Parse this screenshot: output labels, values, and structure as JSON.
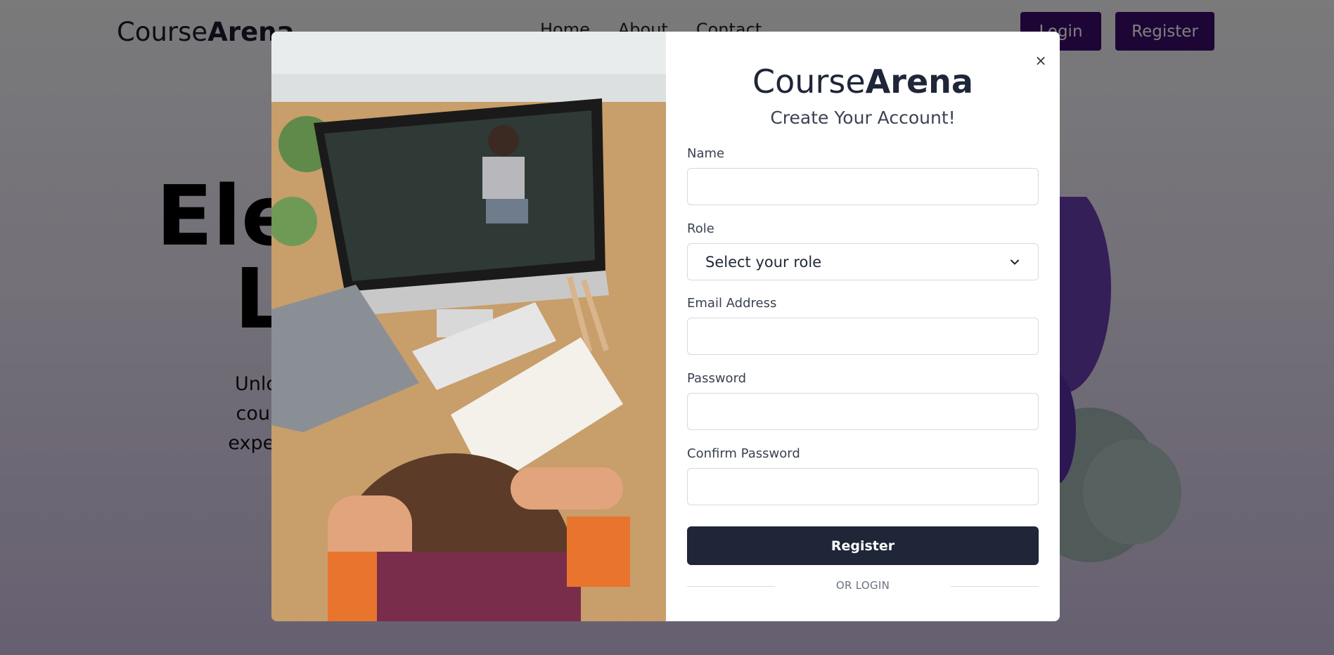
{
  "navbar": {
    "brand_prefix": "Course",
    "brand_suffix": "Arena",
    "links": [
      "Home",
      "About",
      "Contact"
    ],
    "login_label": "Login",
    "register_label": "Register"
  },
  "hero": {
    "title_line1": "Elev",
    "title_line2": "Le",
    "subtitle_lines": [
      "Unlock y",
      "courses.",
      "experts, a"
    ]
  },
  "modal": {
    "close_label": "×",
    "brand_prefix": "Course",
    "brand_suffix": "Arena",
    "subtitle": "Create Your Account!",
    "fields": {
      "name_label": "Name",
      "name_value": "",
      "role_label": "Role",
      "role_selected": "Select your role",
      "email_label": "Email Address",
      "email_value": "",
      "password_label": "Password",
      "password_value": "",
      "confirm_label": "Confirm Password",
      "confirm_value": ""
    },
    "register_label": "Register",
    "or_login_label": "OR LOGIN"
  },
  "colors": {
    "nav_button": "#3b0a6b",
    "primary_button": "#1e2638",
    "overlay": "rgba(0,0,0,0.5)"
  },
  "icons": {
    "close": "close-icon",
    "select": "chevron-down-icon"
  }
}
